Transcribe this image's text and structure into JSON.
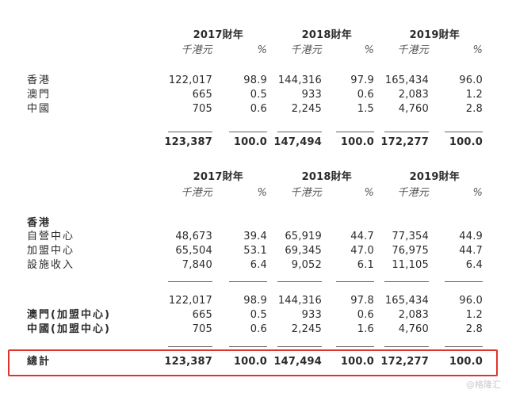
{
  "header_years": [
    "2017財年",
    "2018財年",
    "2019財年"
  ],
  "unit_labels": {
    "hkd": "千港元",
    "pct": "%"
  },
  "table1": {
    "rows": [
      {
        "label": "香港",
        "v": [
          "122,017",
          "98.9",
          "144,316",
          "97.9",
          "165,434",
          "96.0"
        ]
      },
      {
        "label": "澳門",
        "v": [
          "665",
          "0.5",
          "933",
          "0.6",
          "2,083",
          "1.2"
        ]
      },
      {
        "label": "中國",
        "v": [
          "705",
          "0.6",
          "2,245",
          "1.5",
          "4,760",
          "2.8"
        ]
      }
    ],
    "total": [
      "123,387",
      "100.0",
      "147,494",
      "100.0",
      "172,277",
      "100.0"
    ]
  },
  "table2": {
    "section_label": "香港",
    "rows": [
      {
        "label": "自營中心",
        "v": [
          "48,673",
          "39.4",
          "65,919",
          "44.7",
          "77,354",
          "44.9"
        ]
      },
      {
        "label": "加盟中心",
        "v": [
          "65,504",
          "53.1",
          "69,345",
          "47.0",
          "76,975",
          "44.7"
        ]
      },
      {
        "label": "設施收入",
        "v": [
          "7,840",
          "6.4",
          "9,052",
          "6.1",
          "11,105",
          "6.4"
        ]
      }
    ],
    "subtotal": [
      "122,017",
      "98.9",
      "144,316",
      "97.8",
      "165,434",
      "96.0"
    ],
    "rows2": [
      {
        "label": "澳門(加盟中心)",
        "v": [
          "665",
          "0.5",
          "933",
          "0.6",
          "2,083",
          "1.2"
        ]
      },
      {
        "label": "中國(加盟中心)",
        "v": [
          "705",
          "0.6",
          "2,245",
          "1.6",
          "4,760",
          "2.8"
        ]
      }
    ],
    "total_label": "總計",
    "total": [
      "123,387",
      "100.0",
      "147,494",
      "100.0",
      "172,277",
      "100.0"
    ]
  },
  "highlight_color": "#e0332d",
  "watermark": "@格隆汇"
}
